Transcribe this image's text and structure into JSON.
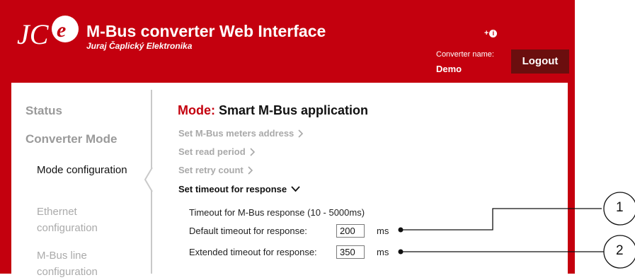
{
  "header": {
    "logo_text": "JCe",
    "title": "M-Bus converter Web Interface",
    "subtitle": "Juraj Čaplický Elektronika",
    "help_label": "+",
    "help_glyph": "i",
    "converter_name_label": "Converter name:",
    "converter_name_value": "Demo",
    "logout_label": "Logout"
  },
  "sidebar": {
    "status": "Status",
    "converter_mode": "Converter Mode",
    "mode_config": "Mode configuration",
    "ethernet_config": "Ethernet configuration",
    "mbus_line_config": "M-Bus line configuration"
  },
  "main": {
    "mode_prefix": "Mode:",
    "mode_value": "Smart M-Bus application",
    "menu": [
      {
        "label": "Set M-Bus meters address",
        "expanded": false
      },
      {
        "label": "Set read period",
        "expanded": false
      },
      {
        "label": "Set retry count",
        "expanded": false
      },
      {
        "label": "Set timeout for response",
        "expanded": true
      }
    ],
    "timeout_section_title": "Timeout for M-Bus response (10 - 5000ms)",
    "default_timeout_label": "Default timeout for response:",
    "default_timeout_value": "200",
    "extended_timeout_label": "Extended timeout for response:",
    "extended_timeout_value": "350",
    "unit": "ms"
  },
  "callouts": [
    "1",
    "2"
  ],
  "colors": {
    "brand_red": "#c4000e",
    "logout_bg": "#6b0e0e"
  }
}
